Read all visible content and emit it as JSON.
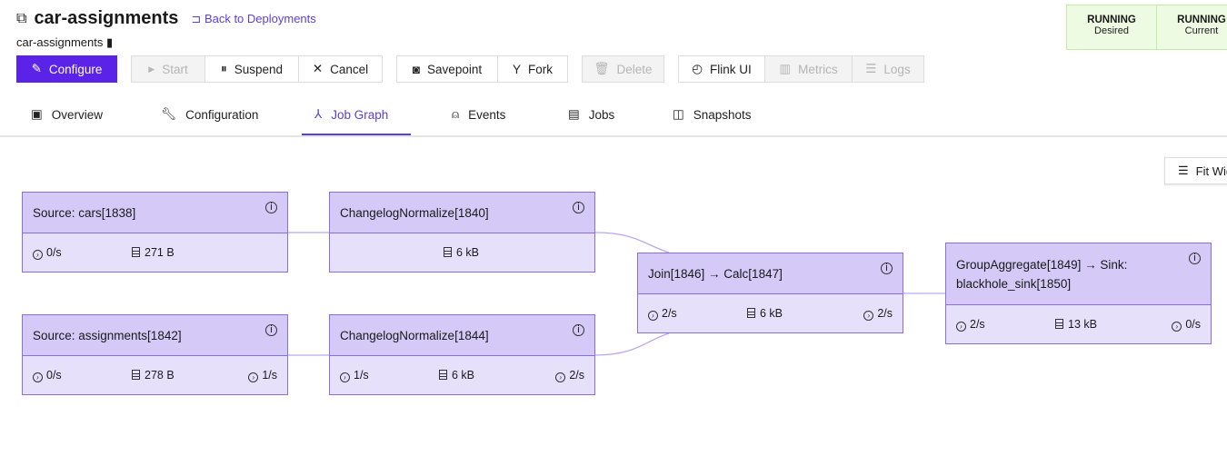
{
  "header": {
    "title": "car-assignments",
    "back_link": "Back to Deployments",
    "subtitle": "car-assignments"
  },
  "toolbar": {
    "configure": "Configure",
    "start": "Start",
    "suspend": "Suspend",
    "cancel": "Cancel",
    "savepoint": "Savepoint",
    "fork": "Fork",
    "delete": "Delete",
    "flink_ui": "Flink UI",
    "metrics": "Metrics",
    "logs": "Logs"
  },
  "status": [
    {
      "state": "RUNNING",
      "label": "Desired"
    },
    {
      "state": "RUNNING",
      "label": "Current"
    }
  ],
  "tabs": [
    {
      "label": "Overview"
    },
    {
      "label": "Configuration"
    },
    {
      "label": "Job Graph",
      "active": true
    },
    {
      "label": "Events"
    },
    {
      "label": "Jobs"
    },
    {
      "label": "Snapshots"
    }
  ],
  "graph": {
    "fit_button": "Fit Width",
    "nodes": [
      {
        "name": "Source: cars[1838]",
        "in": "0/s",
        "state": "271 B",
        "out": ""
      },
      {
        "name": "ChangelogNormalize[1840]",
        "in": "",
        "state": "6 kB",
        "out": ""
      },
      {
        "name": "Source: assignments[1842]",
        "in": "0/s",
        "state": "278 B",
        "out": "1/s"
      },
      {
        "name": "ChangelogNormalize[1844]",
        "in": "1/s",
        "state": "6 kB",
        "out": "2/s"
      },
      {
        "name": "Join[1846] → Calc[1847]",
        "in": "2/s",
        "state": "6 kB",
        "out": "2/s"
      },
      {
        "name": "GroupAggregate[1849] → Sink: blackhole_sink[1850]",
        "in": "2/s",
        "state": "13 kB",
        "out": "0/s"
      }
    ],
    "edges": [
      [
        0,
        1
      ],
      [
        2,
        3
      ],
      [
        1,
        4
      ],
      [
        3,
        4
      ],
      [
        4,
        5
      ]
    ]
  }
}
